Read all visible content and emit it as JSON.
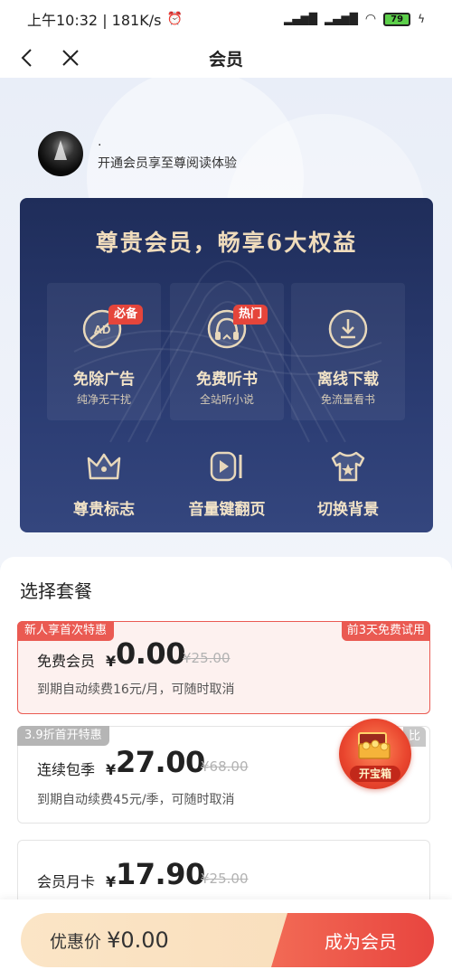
{
  "status_bar": {
    "time_speed": "上午10:32 | 181K/s",
    "battery": "79"
  },
  "nav": {
    "title": "会员"
  },
  "user": {
    "name": ".",
    "subtitle": "开通会员享至尊阅读体验"
  },
  "benefits": {
    "title": "尊贵会员，畅享6大权益",
    "items": [
      {
        "name": "免除广告",
        "sub": "纯净无干扰",
        "tag": "必备",
        "icon": "no-ad-icon"
      },
      {
        "name": "免费听书",
        "sub": "全站听小说",
        "tag": "热门",
        "icon": "headphone-book-icon"
      },
      {
        "name": "离线下载",
        "sub": "免流量看书",
        "tag": "",
        "icon": "download-icon"
      },
      {
        "name": "尊贵标志",
        "sub": "",
        "tag": "",
        "icon": "crown-icon"
      },
      {
        "name": "音量键翻页",
        "sub": "",
        "tag": "",
        "icon": "page-turn-icon"
      },
      {
        "name": "切换背景",
        "sub": "",
        "tag": "",
        "icon": "tshirt-icon"
      }
    ]
  },
  "plans": {
    "title": "选择套餐",
    "items": [
      {
        "ribbon": "新人享首次特惠",
        "trial": "前3天免费试用",
        "name": "免费会员",
        "yen": "¥",
        "price": "0.00",
        "orig": "¥25.00",
        "desc": "到期自动续费16元/月，可随时取消"
      },
      {
        "ribbon": "3.9折首开特惠",
        "extra": "比",
        "name": "连续包季",
        "yen": "¥",
        "price": "27.00",
        "orig": "¥68.00",
        "desc": "到期自动续费45元/季，可随时取消"
      },
      {
        "name": "会员月卡",
        "yen": "¥",
        "price": "17.90",
        "orig": "¥25.00"
      }
    ]
  },
  "treasure": {
    "label": "开宝箱"
  },
  "bottom": {
    "discount_label": "优惠价",
    "discount_amount": "¥0.00",
    "cta": "成为会员"
  }
}
